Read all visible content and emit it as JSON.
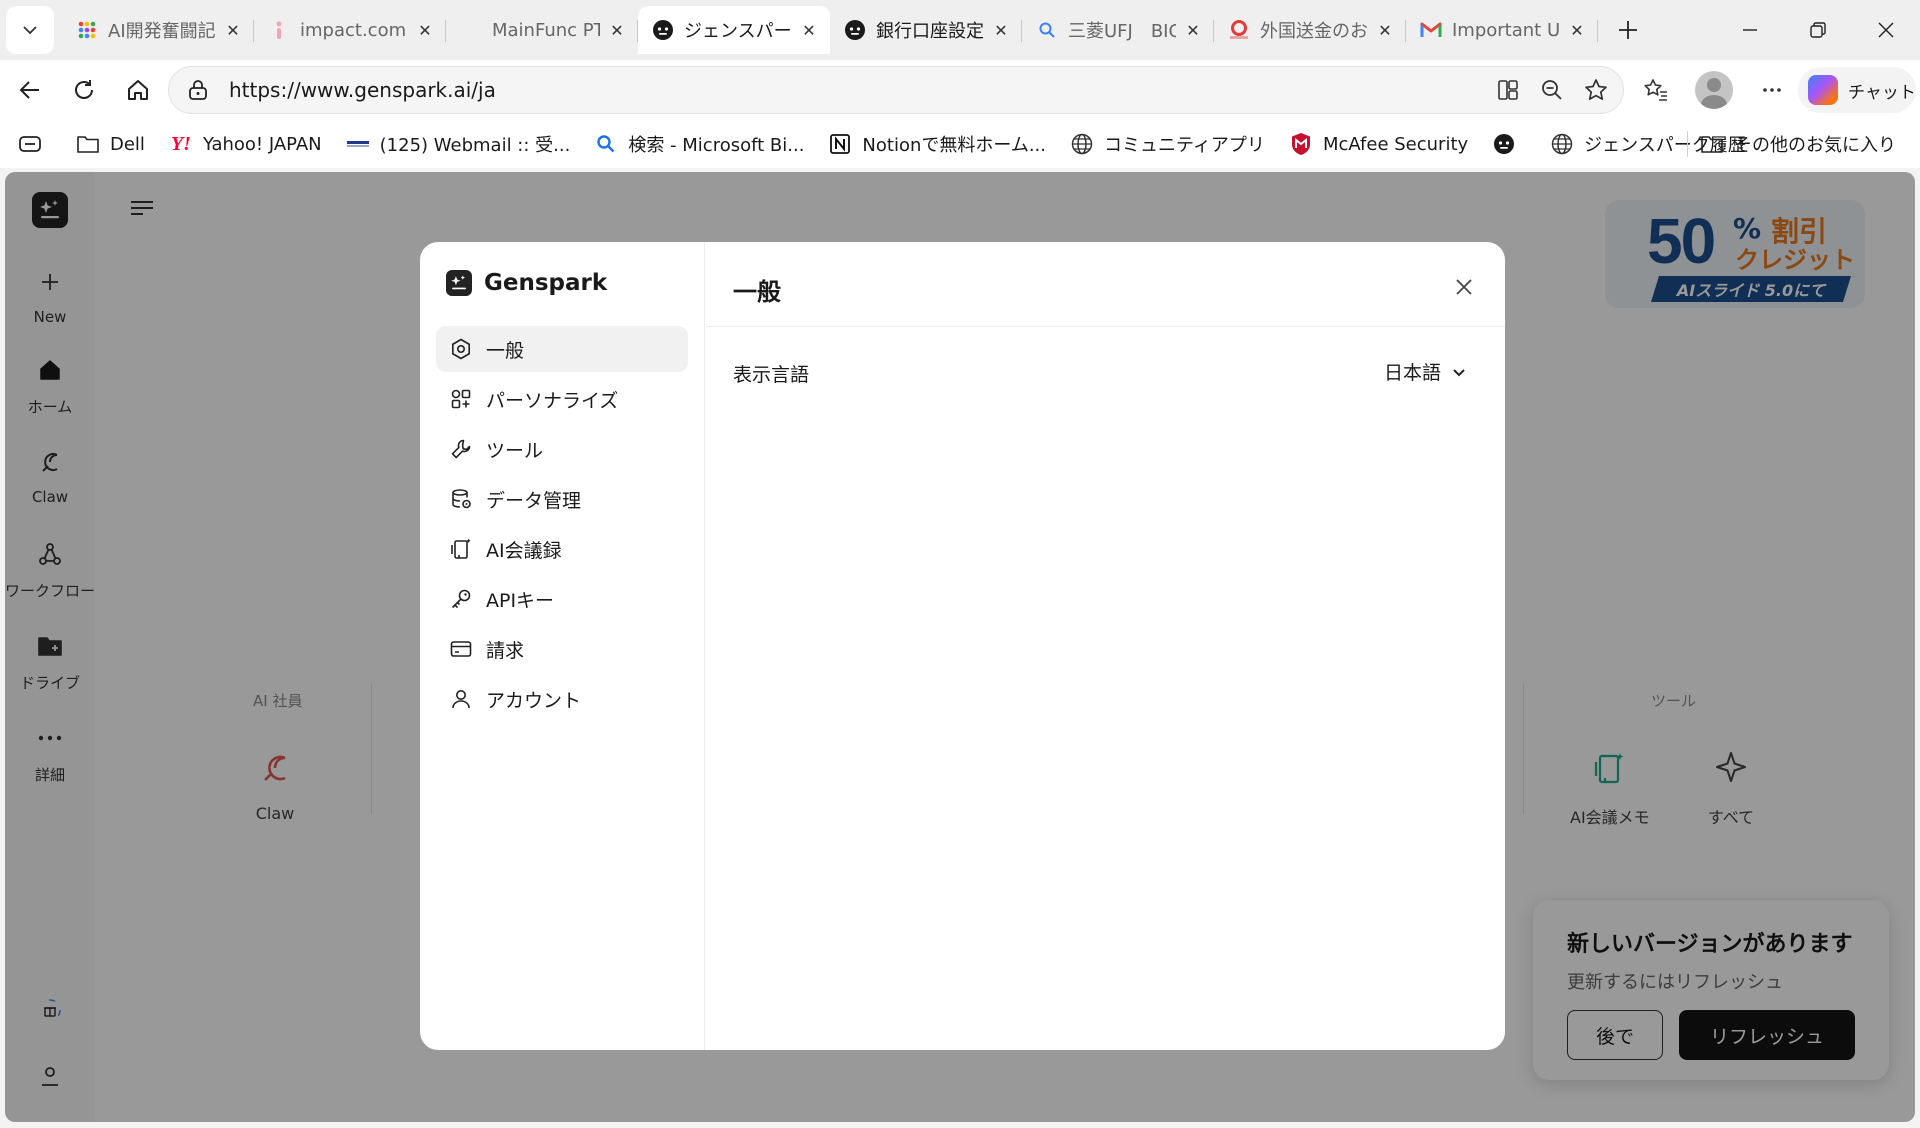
{
  "browser": {
    "tabs": [
      {
        "label": "AI開発奮闘記",
        "icon": "apps-grid-icon",
        "active": false
      },
      {
        "label": "impact.com -",
        "icon": "impact-favicon-icon",
        "active": false
      },
      {
        "label": "MainFunc PTE",
        "icon": "blank-favicon-icon",
        "active": false
      },
      {
        "label": "ジェンスパーク(G",
        "icon": "genspark-favicon-icon",
        "active": true
      },
      {
        "label": "銀行口座設定",
        "icon": "genspark-favicon-icon",
        "active": false
      },
      {
        "label": "三菱UFJ　BIC",
        "icon": "search-favicon-icon",
        "active": false
      },
      {
        "label": "外国送金のお引",
        "icon": "mufg-favicon-icon",
        "active": false
      },
      {
        "label": "Important Up",
        "icon": "gmail-favicon-icon",
        "active": false
      }
    ],
    "url": "https://www.genspark.ai/ja",
    "chat_label": "チャット",
    "bookmarks": [
      {
        "label": "Dell",
        "icon": "folder-icon"
      },
      {
        "label": "Yahoo! JAPAN",
        "icon": "yahoo-icon"
      },
      {
        "label": "(125) Webmail :: 受...",
        "icon": "webmail-icon"
      },
      {
        "label": "検索 - Microsoft Bi...",
        "icon": "bing-search-icon"
      },
      {
        "label": "Notionで無料ホーム...",
        "icon": "notion-icon"
      },
      {
        "label": "コミュニティアプリ",
        "icon": "globe-icon"
      },
      {
        "label": "McAfee Security",
        "icon": "mcafee-icon"
      },
      {
        "label": "",
        "icon": "genspark-favicon-icon"
      },
      {
        "label": "ジェンスパーク履歴",
        "icon": "globe-icon"
      }
    ],
    "other_favorites": "その他のお気に入り"
  },
  "sidebar": {
    "items": [
      {
        "label": "New",
        "icon": "plus-icon"
      },
      {
        "label": "ホーム",
        "icon": "home-icon"
      },
      {
        "label": "Claw",
        "icon": "claw-icon"
      },
      {
        "label": "ワークフロー",
        "icon": "workflow-icon"
      },
      {
        "label": "ドライブ",
        "icon": "drive-folder-icon"
      },
      {
        "label": "詳細",
        "icon": "more-dots-icon"
      }
    ]
  },
  "promo_banner": {
    "number": "50",
    "percent": "%",
    "discount": "割引",
    "credit": "クレジット",
    "slides": "AIスライド 5.0にて"
  },
  "main": {
    "ai_staff_label": "AI 社員",
    "ai_staff_cards": [
      {
        "label": "Claw",
        "icon": "claw-icon"
      }
    ],
    "tools_label": "ツール",
    "tool_cards": [
      {
        "label": "AI会議メモ",
        "icon": "meeting-notes-icon"
      },
      {
        "label": "すべて",
        "icon": "sparkle-icon"
      }
    ]
  },
  "update_toast": {
    "title": "新しいバージョンがあります",
    "subtitle": "更新するにはリフレッシュ",
    "later_label": "後で",
    "refresh_label": "リフレッシュ"
  },
  "settings_modal": {
    "brand": "Genspark",
    "menu": [
      {
        "label": "一般",
        "icon": "settings-gear-icon",
        "active": true
      },
      {
        "label": "パーソナライズ",
        "icon": "personalize-icon",
        "active": false
      },
      {
        "label": "ツール",
        "icon": "wrench-icon",
        "active": false
      },
      {
        "label": "データ管理",
        "icon": "database-icon",
        "active": false
      },
      {
        "label": "AI会議録",
        "icon": "meeting-record-icon",
        "active": false
      },
      {
        "label": "APIキー",
        "icon": "key-icon",
        "active": false
      },
      {
        "label": "請求",
        "icon": "credit-card-icon",
        "active": false
      },
      {
        "label": "アカウント",
        "icon": "user-icon",
        "active": false
      }
    ],
    "title": "一般",
    "display_language_label": "表示言語",
    "display_language_value": "日本語"
  },
  "colors": {
    "accent_dark": "#141414",
    "claw_red": "#e0584f",
    "tool_teal": "#1fa88a",
    "promo_blue": "#1d4e8c",
    "promo_orange": "#e8791e"
  }
}
